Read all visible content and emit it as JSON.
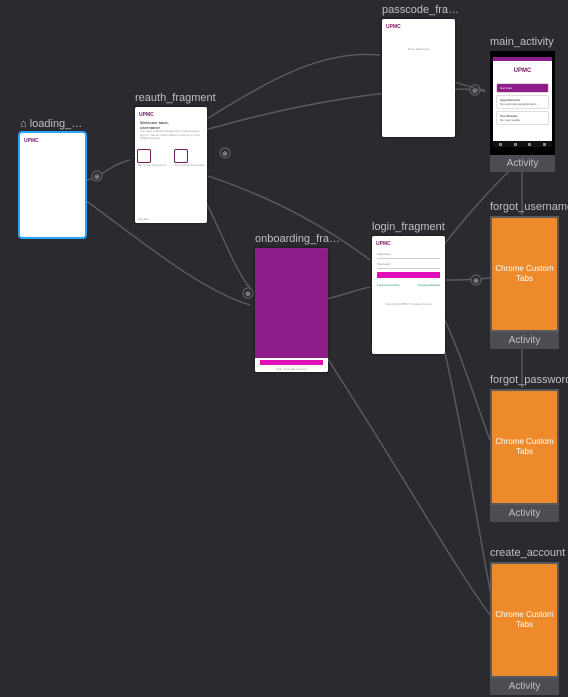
{
  "nodes": {
    "loading": {
      "title": "loading_fra…",
      "logo": "UPMC"
    },
    "reauth": {
      "title": "reauth_fragment",
      "logo": "UPMC",
      "heading": "Welcome back,",
      "subheading": "username!",
      "body": "You have enabled Fingerprint or Passcode to sign in. Tap an option below to sign in to your UPMC account.",
      "icon1_label": "Tap to use Fingerprint",
      "icon2_label": "Tap to Enter Passcode",
      "footer": "Log Out"
    },
    "passcode": {
      "title": "passcode_frag…",
      "logo": "UPMC",
      "heading": "Enter Passcode"
    },
    "onboarding": {
      "title": "onboarding_fra…",
      "btn": " ",
      "footer": "Sign In    Create Account"
    },
    "login": {
      "title": "login_fragment",
      "logo": "UPMC",
      "field1": "Username",
      "field2": "Password",
      "btn": " ",
      "link1": "Forgot username",
      "link2": "Forgot password",
      "hint": "New to MyUPMC? Create Account"
    },
    "main": {
      "title": "main_activity",
      "logo": "UPMC",
      "card1": "Get Care",
      "card2a": "Appointments",
      "card2b": "No upcoming appointments",
      "card3a": "Test Results",
      "card3b": "No new results",
      "activity_label": "Activity"
    },
    "forgot_username": {
      "title": "forgot_username",
      "box": "Chrome Custom Tabs",
      "activity_label": "Activity"
    },
    "forgot_password": {
      "title": "forgot_password",
      "box": "Chrome Custom Tabs",
      "activity_label": "Activity"
    },
    "create_account": {
      "title": "create_account",
      "box": "Chrome Custom Tabs",
      "activity_label": "Activity"
    }
  }
}
